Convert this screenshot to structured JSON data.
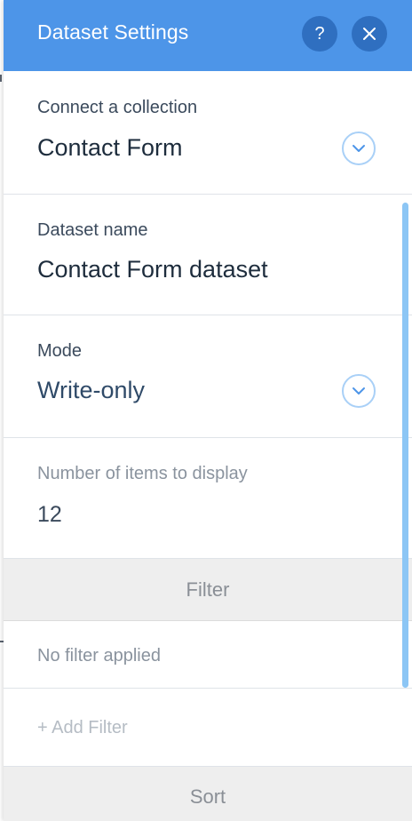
{
  "header": {
    "title": "Dataset Settings",
    "help_icon": "?",
    "close_icon": "✕"
  },
  "collection": {
    "label": "Connect a collection",
    "value": "Contact Form"
  },
  "dataset_name": {
    "label": "Dataset name",
    "value": "Contact Form dataset"
  },
  "mode": {
    "label": "Mode",
    "value": "Write-only"
  },
  "items": {
    "label": "Number of items to display",
    "value": "12"
  },
  "filter": {
    "header": "Filter",
    "status": "No filter applied",
    "add_label": "+ Add Filter"
  },
  "sort": {
    "header": "Sort"
  },
  "colors": {
    "header_bg": "#4d95e8",
    "header_button_bg": "#2f6fc0",
    "chevron_ring": "#a9d0f7",
    "scrollbar": "#8cc6f5"
  }
}
